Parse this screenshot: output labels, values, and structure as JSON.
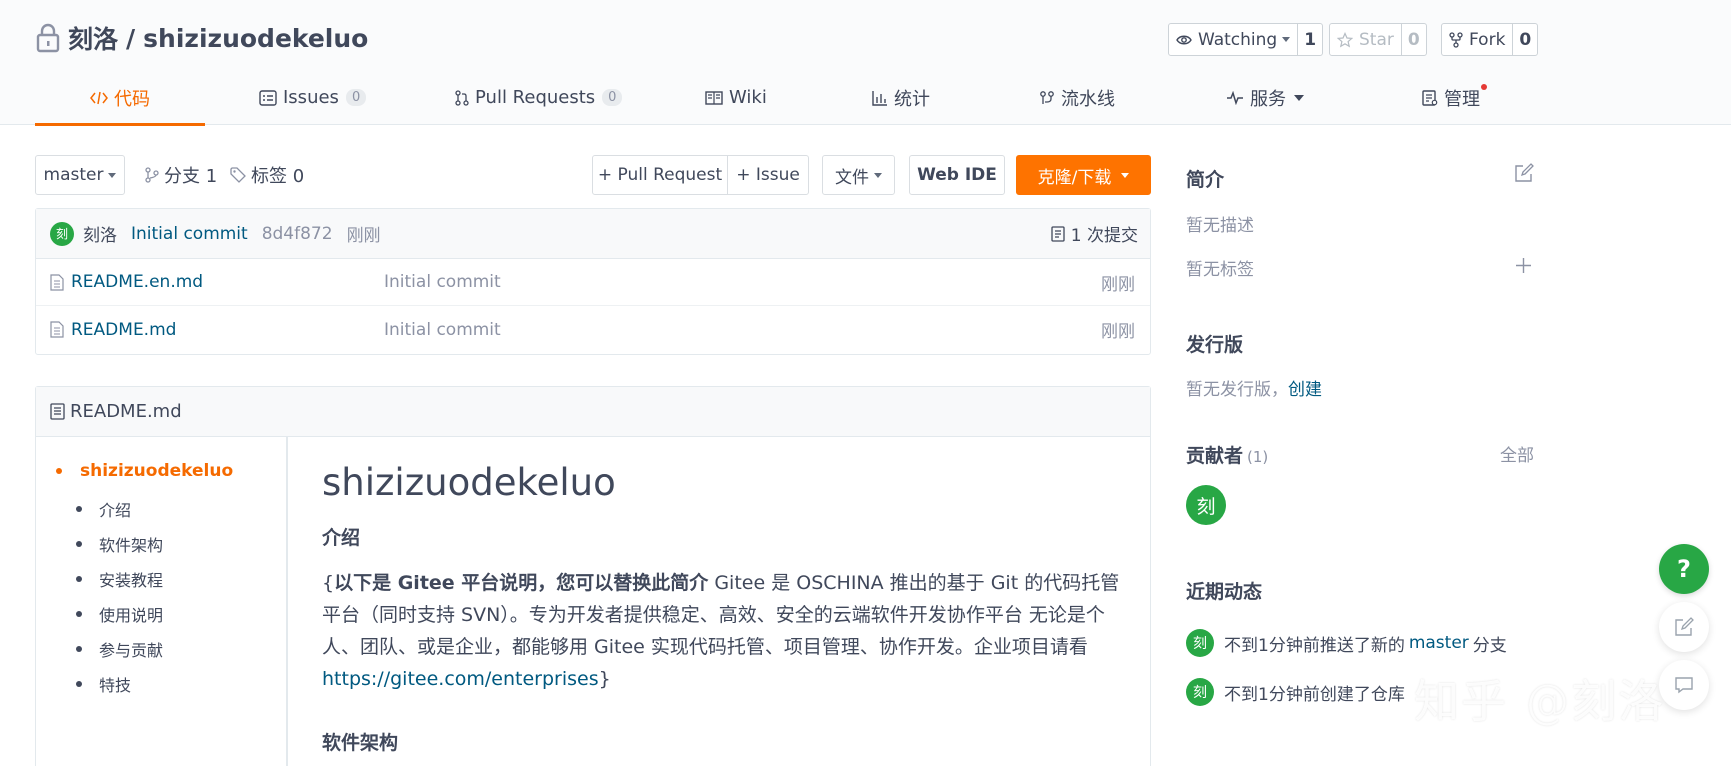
{
  "repo": {
    "owner": "刻洛",
    "separator": "/",
    "name": "shizizuodekeluo"
  },
  "social": {
    "watch_label": "Watching",
    "watch_count": "1",
    "star_label": "Star",
    "star_count": "0",
    "fork_label": "Fork",
    "fork_count": "0"
  },
  "tabs": [
    {
      "label": "代码",
      "active": true
    },
    {
      "label": "Issues",
      "badge": "0"
    },
    {
      "label": "Pull Requests",
      "badge": "0"
    },
    {
      "label": "Wiki"
    },
    {
      "label": "统计"
    },
    {
      "label": "流水线"
    },
    {
      "label": "服务"
    },
    {
      "label": "管理"
    }
  ],
  "toolbar": {
    "branch": "master",
    "branches": "分支 1",
    "tags": "标签 0",
    "pull_request": "+ Pull Request",
    "issue": "+ Issue",
    "file": "文件",
    "web_ide": "Web IDE",
    "clone": "克隆/下载"
  },
  "commit": {
    "avatar": "刻",
    "author": "刻洛",
    "message": "Initial commit",
    "sha": "8d4f872",
    "time": "刚刚",
    "commits": "1 次提交"
  },
  "files": [
    {
      "name": "README.en.md",
      "message": "Initial commit",
      "time": "刚刚"
    },
    {
      "name": "README.md",
      "message": "Initial commit",
      "time": "刚刚"
    }
  ],
  "readme": {
    "filename": "README.md",
    "toc_title": "shizizuodekeluo",
    "toc": [
      "介绍",
      "软件架构",
      "安装教程",
      "使用说明",
      "参与贡献",
      "特技"
    ],
    "h1": "shizizuodekeluo",
    "intro_heading": "介绍",
    "intro_open": "{",
    "intro_bold": "以下是 Gitee 平台说明，您可以替换此简介",
    "intro_text": " Gitee 是 OSCHINA 推出的基于 Git 的代码托管平台（同时支持 SVN）。专为开发者提供稳定、高效、安全的云端软件开发协作平台 无论是个人、团队、或是企业，都能够用 Gitee 实现代码托管、项目管理、协作开发。企业项目请看 ",
    "intro_link": "https://gitee.com/enterprises",
    "intro_close": "}",
    "arch_heading": "软件架构"
  },
  "sidebar": {
    "intro_title": "简介",
    "no_desc": "暂无描述",
    "no_tags": "暂无标签",
    "release_title": "发行版",
    "no_release": "暂无发行版，",
    "create": "创建",
    "contrib_title": "贡献者",
    "contrib_count": "(1)",
    "all": "全部",
    "contrib_avatar": "刻",
    "activity_title": "近期动态",
    "activities": [
      {
        "avatar": "刻",
        "before": "不到1分钟前推送了新的",
        "link": "master",
        "after": "分支"
      },
      {
        "avatar": "刻",
        "before": "不到1分钟前创建了仓库",
        "link": "",
        "after": ""
      }
    ]
  },
  "float": {
    "help": "?"
  },
  "watermark": "知乎 @刻洛",
  "colors": {
    "accent": "#fe7300",
    "link": "#005980",
    "avatar": "#28a745"
  }
}
